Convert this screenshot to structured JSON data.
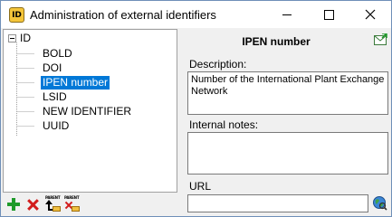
{
  "window": {
    "title": "Administration of external identifiers",
    "app_icon_text": "ID"
  },
  "tree": {
    "root_label": "ID",
    "items": [
      {
        "label": "BOLD",
        "selected": false
      },
      {
        "label": "DOI",
        "selected": false
      },
      {
        "label": "IPEN number",
        "selected": true
      },
      {
        "label": "LSID",
        "selected": false
      },
      {
        "label": "NEW IDENTIFIER",
        "selected": false
      },
      {
        "label": "UUID",
        "selected": false
      }
    ]
  },
  "toolbar": {
    "add_icon": "plus-icon",
    "delete_icon": "delete-icon",
    "set_parent_label": "PARENT",
    "remove_parent_label": "PARENT"
  },
  "detail": {
    "title": "IPEN number",
    "description_label": "Description:",
    "description_value": "Number of the International Plant Exchange Network",
    "internal_notes_label": "Internal notes:",
    "internal_notes_value": "",
    "url_label": "URL",
    "url_value": ""
  },
  "colors": {
    "selection": "#0078d7",
    "add_green": "#1e9a2a",
    "delete_red": "#d21c1c"
  }
}
